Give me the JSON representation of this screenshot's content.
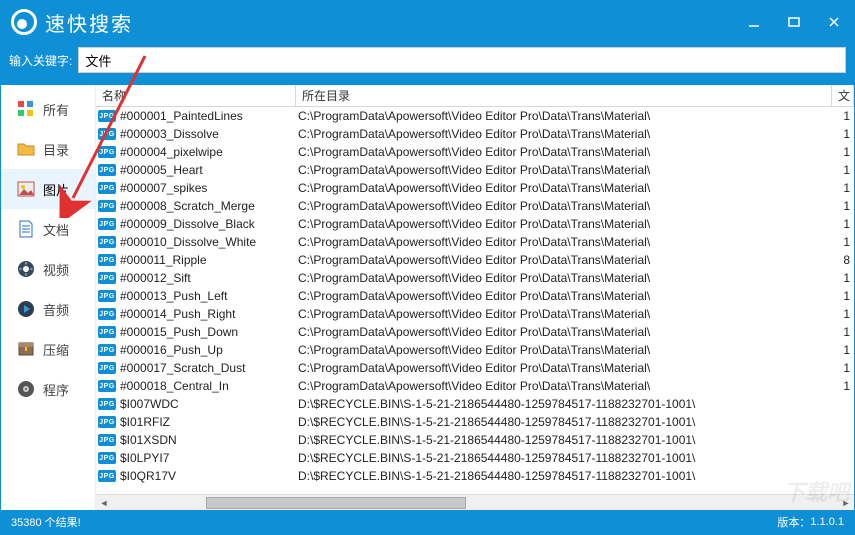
{
  "window": {
    "title": "速快搜索"
  },
  "search": {
    "label": "输入关键字:",
    "value": "文件"
  },
  "sidebar": {
    "items": [
      {
        "id": "all",
        "label": "所有",
        "icon": "grid-icon"
      },
      {
        "id": "dir",
        "label": "目录",
        "icon": "folder-icon"
      },
      {
        "id": "image",
        "label": "图片",
        "icon": "image-icon",
        "selected": true
      },
      {
        "id": "doc",
        "label": "文档",
        "icon": "document-icon"
      },
      {
        "id": "video",
        "label": "视频",
        "icon": "video-icon"
      },
      {
        "id": "audio",
        "label": "音频",
        "icon": "audio-icon"
      },
      {
        "id": "zip",
        "label": "压缩",
        "icon": "archive-icon"
      },
      {
        "id": "prog",
        "label": "程序",
        "icon": "program-icon"
      }
    ]
  },
  "columns": {
    "name": "名称",
    "dir": "所在目录",
    "ext": "文"
  },
  "rows": [
    {
      "tag": "JPG",
      "name": "#000001_PaintedLines",
      "dir": "C:\\ProgramData\\Apowersoft\\Video Editor Pro\\Data\\Trans\\Material\\",
      "n": "1"
    },
    {
      "tag": "JPG",
      "name": "#000003_Dissolve",
      "dir": "C:\\ProgramData\\Apowersoft\\Video Editor Pro\\Data\\Trans\\Material\\",
      "n": "1"
    },
    {
      "tag": "JPG",
      "name": "#000004_pixelwipe",
      "dir": "C:\\ProgramData\\Apowersoft\\Video Editor Pro\\Data\\Trans\\Material\\",
      "n": "1"
    },
    {
      "tag": "JPG",
      "name": "#000005_Heart",
      "dir": "C:\\ProgramData\\Apowersoft\\Video Editor Pro\\Data\\Trans\\Material\\",
      "n": "1"
    },
    {
      "tag": "JPG",
      "name": "#000007_spikes",
      "dir": "C:\\ProgramData\\Apowersoft\\Video Editor Pro\\Data\\Trans\\Material\\",
      "n": "1"
    },
    {
      "tag": "JPG",
      "name": "#000008_Scratch_Merge",
      "dir": "C:\\ProgramData\\Apowersoft\\Video Editor Pro\\Data\\Trans\\Material\\",
      "n": "1"
    },
    {
      "tag": "JPG",
      "name": "#000009_Dissolve_Black",
      "dir": "C:\\ProgramData\\Apowersoft\\Video Editor Pro\\Data\\Trans\\Material\\",
      "n": "1"
    },
    {
      "tag": "JPG",
      "name": "#000010_Dissolve_White",
      "dir": "C:\\ProgramData\\Apowersoft\\Video Editor Pro\\Data\\Trans\\Material\\",
      "n": "1"
    },
    {
      "tag": "JPG",
      "name": "#000011_Ripple",
      "dir": "C:\\ProgramData\\Apowersoft\\Video Editor Pro\\Data\\Trans\\Material\\",
      "n": "8"
    },
    {
      "tag": "JPG",
      "name": "#000012_Sift",
      "dir": "C:\\ProgramData\\Apowersoft\\Video Editor Pro\\Data\\Trans\\Material\\",
      "n": "1"
    },
    {
      "tag": "JPG",
      "name": "#000013_Push_Left",
      "dir": "C:\\ProgramData\\Apowersoft\\Video Editor Pro\\Data\\Trans\\Material\\",
      "n": "1"
    },
    {
      "tag": "JPG",
      "name": "#000014_Push_Right",
      "dir": "C:\\ProgramData\\Apowersoft\\Video Editor Pro\\Data\\Trans\\Material\\",
      "n": "1"
    },
    {
      "tag": "JPG",
      "name": "#000015_Push_Down",
      "dir": "C:\\ProgramData\\Apowersoft\\Video Editor Pro\\Data\\Trans\\Material\\",
      "n": "1"
    },
    {
      "tag": "JPG",
      "name": "#000016_Push_Up",
      "dir": "C:\\ProgramData\\Apowersoft\\Video Editor Pro\\Data\\Trans\\Material\\",
      "n": "1"
    },
    {
      "tag": "JPG",
      "name": "#000017_Scratch_Dust",
      "dir": "C:\\ProgramData\\Apowersoft\\Video Editor Pro\\Data\\Trans\\Material\\",
      "n": "1"
    },
    {
      "tag": "JPG",
      "name": "#000018_Central_In",
      "dir": "C:\\ProgramData\\Apowersoft\\Video Editor Pro\\Data\\Trans\\Material\\",
      "n": "1"
    },
    {
      "tag": "JPG",
      "name": "$I007WDC",
      "dir": "D:\\$RECYCLE.BIN\\S-1-5-21-2186544480-1259784517-1188232701-1001\\",
      "n": ""
    },
    {
      "tag": "JPG",
      "name": "$I01RFIZ",
      "dir": "D:\\$RECYCLE.BIN\\S-1-5-21-2186544480-1259784517-1188232701-1001\\",
      "n": ""
    },
    {
      "tag": "JPG",
      "name": "$I01XSDN",
      "dir": "D:\\$RECYCLE.BIN\\S-1-5-21-2186544480-1259784517-1188232701-1001\\",
      "n": ""
    },
    {
      "tag": "JPG",
      "name": "$I0LPYI7",
      "dir": "D:\\$RECYCLE.BIN\\S-1-5-21-2186544480-1259784517-1188232701-1001\\",
      "n": ""
    },
    {
      "tag": "JPG",
      "name": "$I0QR17V",
      "dir": "D:\\$RECYCLE.BIN\\S-1-5-21-2186544480-1259784517-1188232701-1001\\",
      "n": ""
    }
  ],
  "status": {
    "count_text": "35380 个结果!",
    "version_label": "版本：",
    "version": "1.1.0.1"
  },
  "watermark": "下载吧"
}
